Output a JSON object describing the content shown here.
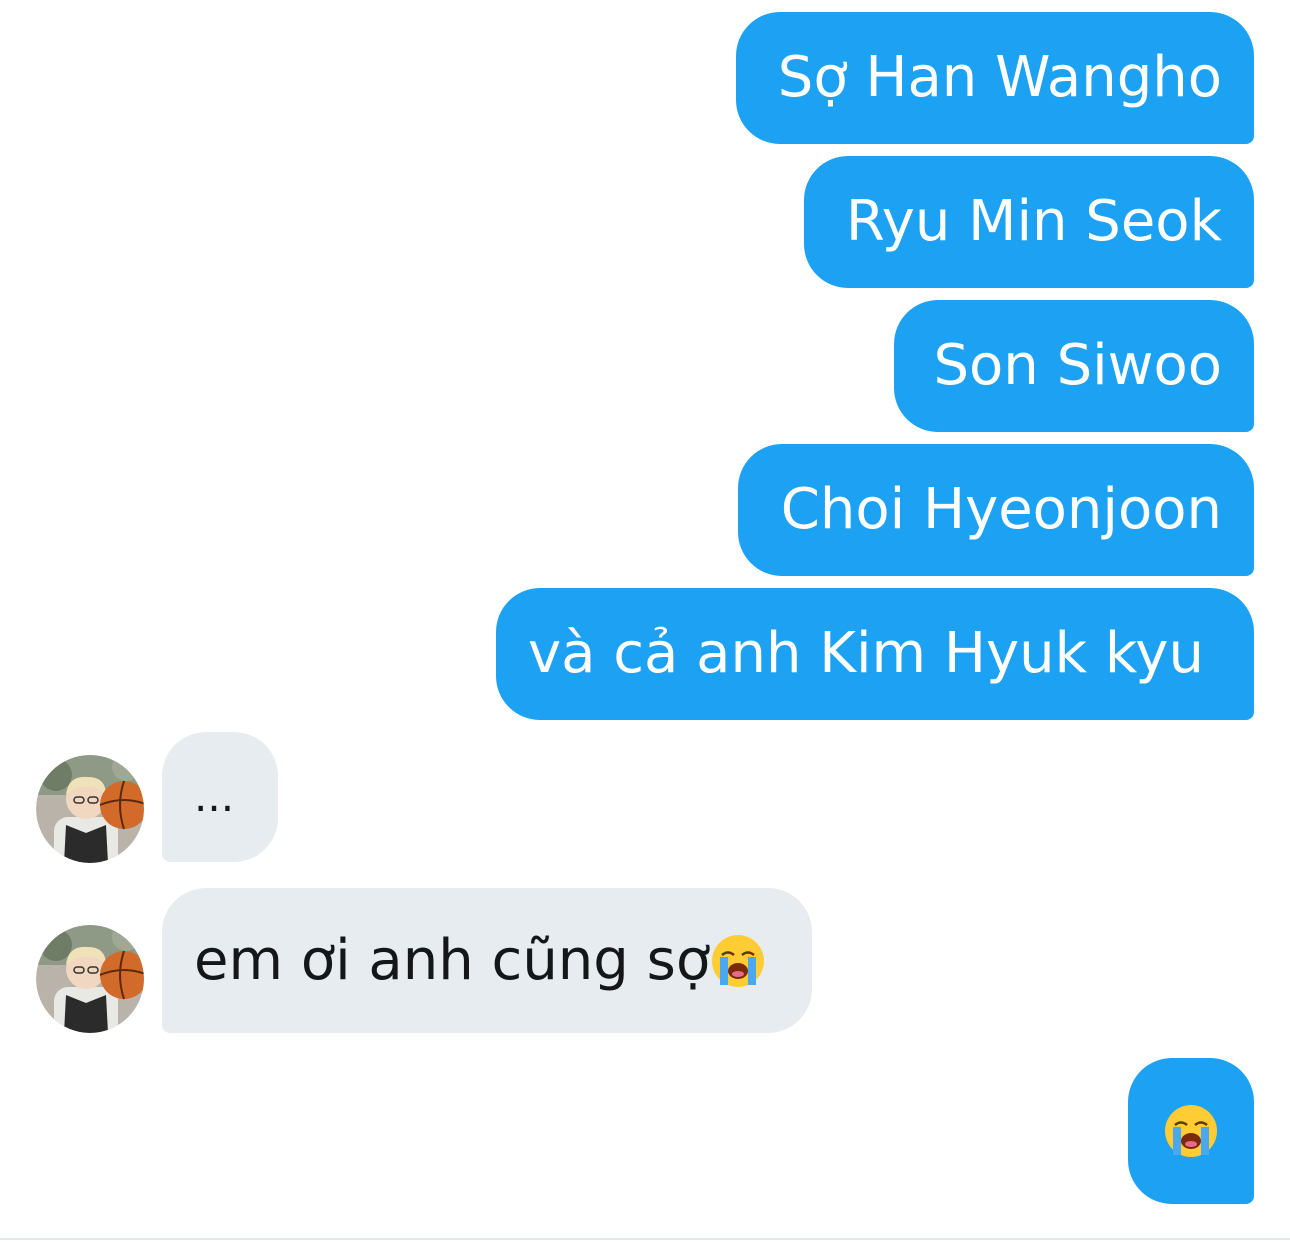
{
  "sent_messages": [
    {
      "text": "Sợ Han Wangho"
    },
    {
      "text": "Ryu Min Seok"
    },
    {
      "text": "Son Siwoo"
    },
    {
      "text": "Choi Hyeonjoon"
    },
    {
      "text": "và cả anh Kim Hyuk kyu"
    }
  ],
  "received_messages": [
    {
      "text": "..."
    },
    {
      "text": "em ơi anh cũng sợ",
      "emoji": "loudly-crying-face-icon"
    }
  ],
  "final_sent": {
    "emoji": "loudly-crying-face-icon"
  },
  "colors": {
    "sent_bubble": "#1da1f2",
    "received_bubble": "#e6ecf0",
    "sent_text": "#ffffff",
    "received_text": "#14171a"
  }
}
